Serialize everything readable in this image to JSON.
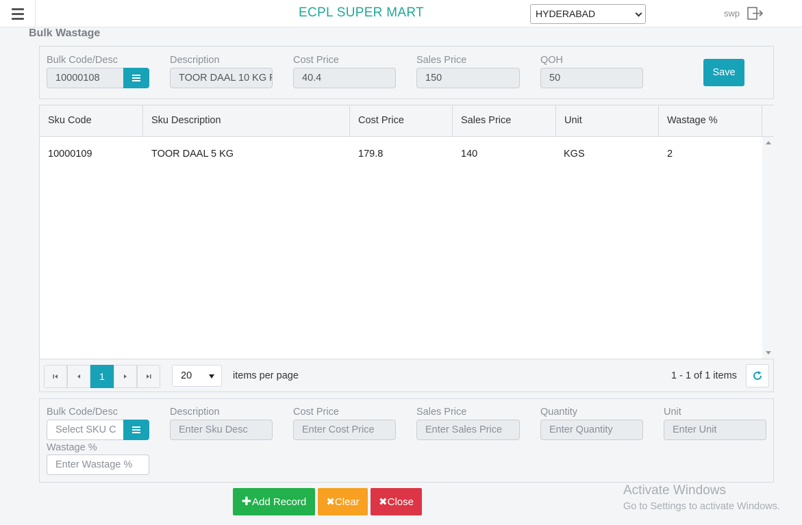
{
  "app": {
    "title": "ECPL SUPER MART",
    "store": "HYDERABAD",
    "user": "swp"
  },
  "page": {
    "title": "Bulk Wastage"
  },
  "header_form": {
    "bulk_code_label": "Bulk Code/Desc",
    "bulk_code_value": "10000108",
    "description_label": "Description",
    "description_value": "TOOR DAAL 10 KG F",
    "cost_price_label": "Cost Price",
    "cost_price_value": "40.4",
    "sales_price_label": "Sales Price",
    "sales_price_value": "150",
    "qoh_label": "QOH",
    "qoh_value": "50",
    "save_label": "Save"
  },
  "grid": {
    "columns": [
      "Sku Code",
      "Sku Description",
      "Cost Price",
      "Sales Price",
      "Unit",
      "Wastage %"
    ],
    "rows": [
      {
        "sku_code": "10000109",
        "sku_description": "TOOR DAAL 5 KG",
        "cost_price": "179.8",
        "sales_price": "140",
        "unit": "KGS",
        "wastage": "2"
      }
    ],
    "pager": {
      "current_page": "1",
      "page_size": "20",
      "items_per_page_label": "items per page",
      "info": "1 - 1 of 1 items"
    }
  },
  "entry_form": {
    "bulk_code_label": "Bulk Code/Desc",
    "bulk_code_placeholder": "Select SKU C",
    "description_label": "Description",
    "description_placeholder": "Enter Sku Desc",
    "cost_price_label": "Cost Price",
    "cost_price_placeholder": "Enter Cost Price",
    "sales_price_label": "Sales Price",
    "sales_price_placeholder": "Enter Sales Price",
    "quantity_label": "Quantity",
    "quantity_placeholder": "Enter Quantity",
    "unit_label": "Unit",
    "unit_placeholder": "Enter Unit",
    "wastage_label": "Wastage %",
    "wastage_placeholder": "Enter Wastage %"
  },
  "actions": {
    "add_label": "Add Record",
    "clear_label": "Clear",
    "close_label": "Close"
  },
  "colors": {
    "accent": "#17a2b8",
    "title": "#1fa896",
    "add": "#22b14c",
    "clear": "#f7a021",
    "close": "#dc3545"
  },
  "watermark": {
    "line1": "Activate Windows",
    "line2": "Go to Settings to activate Windows."
  }
}
